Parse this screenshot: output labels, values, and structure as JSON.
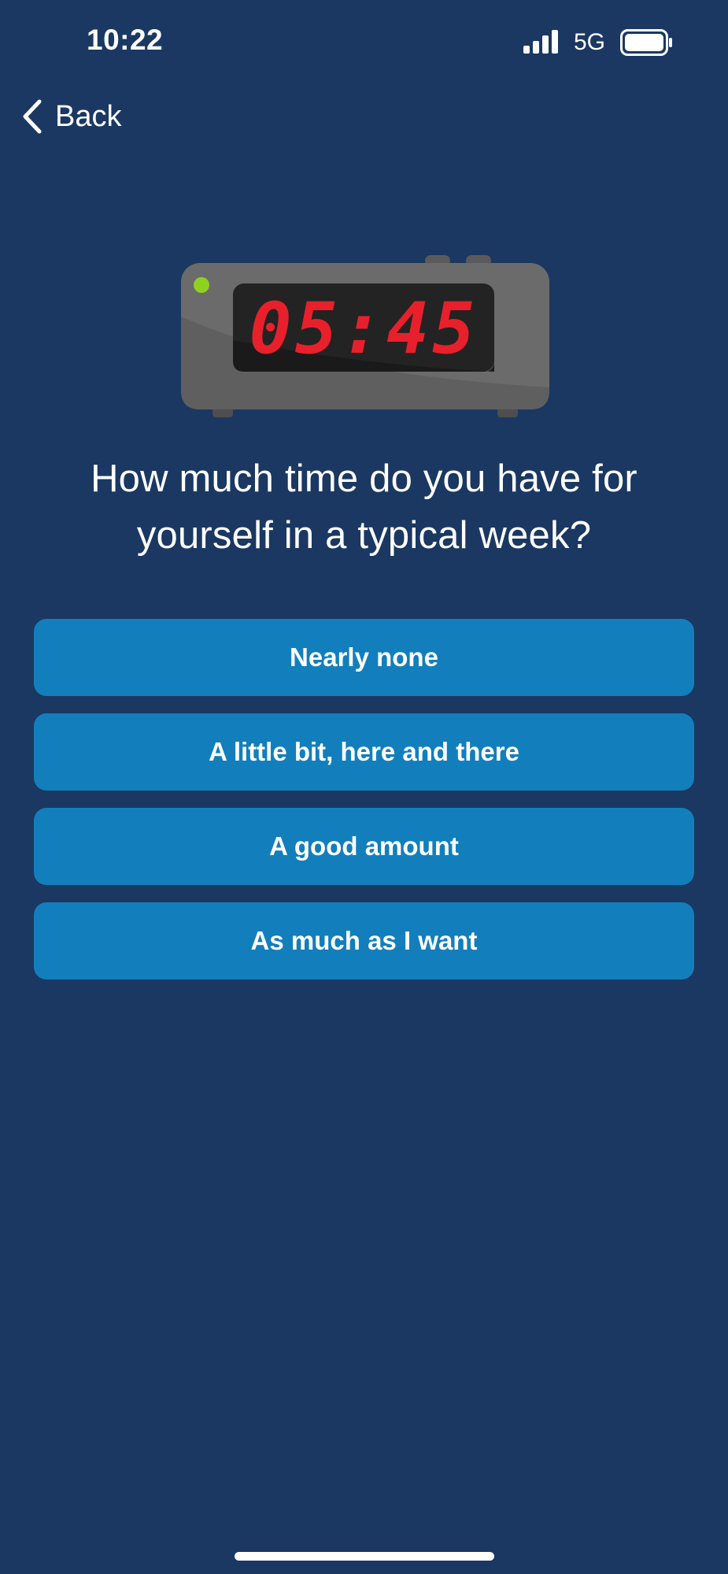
{
  "status_bar": {
    "time": "10:22",
    "network": "5G",
    "signal_icon": "cellular-signal-icon",
    "battery_icon": "battery-icon"
  },
  "nav": {
    "back_label": "Back",
    "back_icon": "chevron-left-icon"
  },
  "illustration": {
    "name": "alarm-clock-illustration",
    "display_time": "05:45",
    "display_color": "#e8202b",
    "body_color": "#6b6b6b",
    "indicator_color": "#8fd11f"
  },
  "question": {
    "line1": "How much time do you have for",
    "line2": "yourself in a typical week?"
  },
  "options": [
    {
      "label": "Nearly none"
    },
    {
      "label": "A little bit, here and there"
    },
    {
      "label": "A good amount"
    },
    {
      "label": "As much as I want"
    }
  ],
  "colors": {
    "background": "#1a3862",
    "option_button": "#127fbc",
    "text": "#ffffff"
  }
}
